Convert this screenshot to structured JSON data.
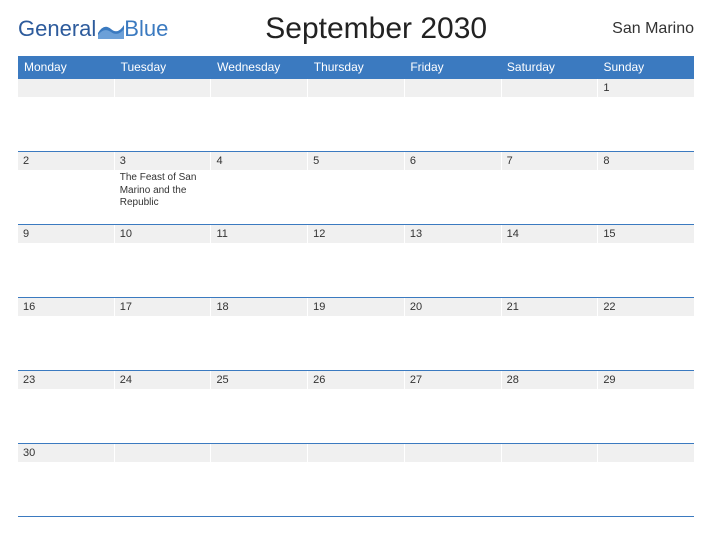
{
  "brand": {
    "name_part1": "General",
    "name_part2": "Blue"
  },
  "title": "September 2030",
  "region": "San Marino",
  "weekdays": [
    "Monday",
    "Tuesday",
    "Wednesday",
    "Thursday",
    "Friday",
    "Saturday",
    "Sunday"
  ],
  "weeks": [
    [
      {
        "day": "",
        "event": ""
      },
      {
        "day": "",
        "event": ""
      },
      {
        "day": "",
        "event": ""
      },
      {
        "day": "",
        "event": ""
      },
      {
        "day": "",
        "event": ""
      },
      {
        "day": "",
        "event": ""
      },
      {
        "day": "1",
        "event": ""
      }
    ],
    [
      {
        "day": "2",
        "event": ""
      },
      {
        "day": "3",
        "event": "The Feast of San Marino and the Republic"
      },
      {
        "day": "4",
        "event": ""
      },
      {
        "day": "5",
        "event": ""
      },
      {
        "day": "6",
        "event": ""
      },
      {
        "day": "7",
        "event": ""
      },
      {
        "day": "8",
        "event": ""
      }
    ],
    [
      {
        "day": "9",
        "event": ""
      },
      {
        "day": "10",
        "event": ""
      },
      {
        "day": "11",
        "event": ""
      },
      {
        "day": "12",
        "event": ""
      },
      {
        "day": "13",
        "event": ""
      },
      {
        "day": "14",
        "event": ""
      },
      {
        "day": "15",
        "event": ""
      }
    ],
    [
      {
        "day": "16",
        "event": ""
      },
      {
        "day": "17",
        "event": ""
      },
      {
        "day": "18",
        "event": ""
      },
      {
        "day": "19",
        "event": ""
      },
      {
        "day": "20",
        "event": ""
      },
      {
        "day": "21",
        "event": ""
      },
      {
        "day": "22",
        "event": ""
      }
    ],
    [
      {
        "day": "23",
        "event": ""
      },
      {
        "day": "24",
        "event": ""
      },
      {
        "day": "25",
        "event": ""
      },
      {
        "day": "26",
        "event": ""
      },
      {
        "day": "27",
        "event": ""
      },
      {
        "day": "28",
        "event": ""
      },
      {
        "day": "29",
        "event": ""
      }
    ],
    [
      {
        "day": "30",
        "event": ""
      },
      {
        "day": "",
        "event": ""
      },
      {
        "day": "",
        "event": ""
      },
      {
        "day": "",
        "event": ""
      },
      {
        "day": "",
        "event": ""
      },
      {
        "day": "",
        "event": ""
      },
      {
        "day": "",
        "event": ""
      }
    ]
  ]
}
